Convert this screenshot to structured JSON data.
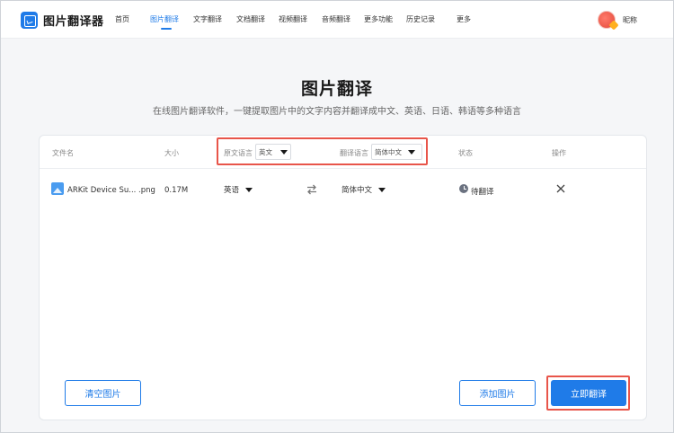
{
  "app": {
    "name": "图片翻译器"
  },
  "nav": {
    "items": [
      {
        "label": "首页"
      },
      {
        "label": "图片翻译"
      },
      {
        "label": "文字翻译"
      },
      {
        "label": "文档翻译"
      },
      {
        "label": "视频翻译"
      },
      {
        "label": "音频翻译"
      },
      {
        "label": "更多功能"
      },
      {
        "label": "历史记录"
      },
      {
        "label": "更多"
      }
    ],
    "active_index": 1
  },
  "user": {
    "name": "昵称"
  },
  "hero": {
    "title": "图片翻译",
    "subtitle": "在线图片翻译软件，一键提取图片中的文字内容并翻译成中文、英语、日语、韩语等多种语言"
  },
  "table": {
    "headers": {
      "filename": "文件名",
      "size": "大小",
      "source_lang": "原文语言",
      "target_lang": "翻译语言",
      "status": "状态",
      "actions": "操作"
    },
    "source_lang_value": "英文",
    "target_lang_value": "简体中文",
    "rows": [
      {
        "filename": "ARKit Device Su... .png",
        "size": "0.17M",
        "source_lang": "英语",
        "target_lang": "简体中文",
        "status": "待翻译"
      }
    ]
  },
  "buttons": {
    "clear": "清空图片",
    "add": "添加图片",
    "translate": "立即翻译"
  },
  "colors": {
    "accent": "#1f7be8",
    "highlight": "#e8554a"
  }
}
